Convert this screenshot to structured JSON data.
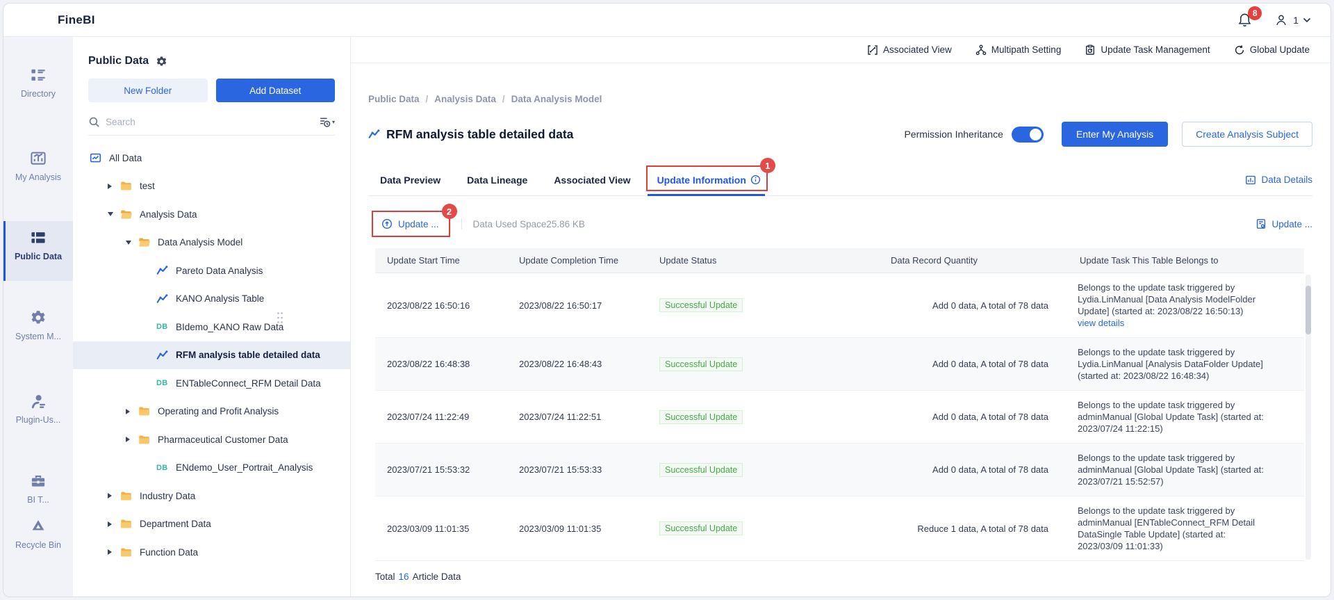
{
  "topbar": {
    "logo": "FineBI",
    "notification_count": "8",
    "user_label": "1"
  },
  "sidebar": {
    "items": [
      {
        "label": "Directory",
        "icon": "directory",
        "active": false,
        "clipped": false
      },
      {
        "label": "My Analysis",
        "icon": "my-analysis",
        "active": false,
        "clipped": false
      },
      {
        "label": "Public Data",
        "icon": "public-data",
        "active": true,
        "clipped": false
      },
      {
        "label": "System M...",
        "icon": "system",
        "active": false,
        "clipped": false
      },
      {
        "label": "Plugin-Us...",
        "icon": "plugin-user",
        "active": false,
        "clipped": false
      },
      {
        "label": "BI T...",
        "icon": "bi-tool",
        "active": false,
        "clipped": true
      },
      {
        "label": "Recycle Bin",
        "icon": "recycle",
        "active": false,
        "clipped": false
      }
    ]
  },
  "panel": {
    "title": "Public Data",
    "new_folder_label": "New Folder",
    "add_dataset_label": "Add Dataset",
    "search_placeholder": "Search",
    "tree": [
      {
        "label": "All Data",
        "type": "all-data",
        "level": 0,
        "state": "none",
        "selected": false
      },
      {
        "label": "test",
        "type": "folder",
        "level": 1,
        "state": "collapsed",
        "selected": false
      },
      {
        "label": "Analysis Data",
        "type": "folder",
        "level": 1,
        "state": "expanded",
        "selected": false
      },
      {
        "label": "Data Analysis Model",
        "type": "folder",
        "level": 2,
        "state": "expanded",
        "selected": false
      },
      {
        "label": "Pareto Data Analysis",
        "type": "analysis",
        "level": 3,
        "state": "none",
        "selected": false
      },
      {
        "label": "KANO Analysis Table",
        "type": "analysis",
        "level": 3,
        "state": "none",
        "selected": false
      },
      {
        "label": "BIdemo_KANO Raw Data",
        "type": "db",
        "level": 3,
        "state": "none",
        "selected": false
      },
      {
        "label": "RFM analysis table detailed data",
        "type": "analysis",
        "level": 3,
        "state": "none",
        "selected": true
      },
      {
        "label": "ENTableConnect_RFM Detail Data",
        "type": "db",
        "level": 3,
        "state": "none",
        "selected": false
      },
      {
        "label": "Operating and Profit Analysis",
        "type": "folder",
        "level": 2,
        "state": "collapsed",
        "selected": false
      },
      {
        "label": "Pharmaceutical Customer Data",
        "type": "folder",
        "level": 2,
        "state": "collapsed",
        "selected": false
      },
      {
        "label": "ENdemo_User_Portrait_Analysis",
        "type": "db",
        "level": 3,
        "state": "none",
        "selected": false
      },
      {
        "label": "Industry Data",
        "type": "folder",
        "level": 1,
        "state": "collapsed",
        "selected": false
      },
      {
        "label": "Department Data",
        "type": "folder",
        "level": 1,
        "state": "collapsed",
        "selected": false
      },
      {
        "label": "Function Data",
        "type": "folder",
        "level": 1,
        "state": "collapsed",
        "selected": false
      }
    ]
  },
  "toolbar": {
    "items": [
      {
        "label": "Associated View",
        "icon": "assoc-view"
      },
      {
        "label": "Multipath Setting",
        "icon": "multipath"
      },
      {
        "label": "Update Task Management",
        "icon": "update-task"
      },
      {
        "label": "Global Update",
        "icon": "global-update"
      }
    ]
  },
  "main": {
    "breadcrumb": [
      "Public Data",
      "Analysis Data",
      "Data Analysis Model"
    ],
    "title": "RFM analysis table detailed data",
    "permission_label": "Permission Inheritance",
    "permission_on": true,
    "enter_button": "Enter My Analysis",
    "create_button": "Create Analysis Subject",
    "tabs": [
      "Data Preview",
      "Data Lineage",
      "Associated View",
      "Update Information"
    ],
    "active_tab": "Update Information",
    "data_details_label": "Data Details",
    "update_button": "Update ...",
    "data_used_space": "Data Used Space25.86 KB",
    "update_link": "Update ...",
    "annotations": {
      "tab_badge": "1",
      "update_badge": "2"
    },
    "table": {
      "columns": [
        "Update Start Time",
        "Update Completion Time",
        "Update Status",
        "Data Record Quantity",
        "Update Task This Table Belongs to"
      ],
      "rows": [
        {
          "start": "2023/08/22 16:50:16",
          "end": "2023/08/22 16:50:17",
          "status": "Successful Update",
          "qty": "Add 0 data, A total of 78 data",
          "task": "Belongs to the update task triggered by Lydia.LinManual [Data Analysis ModelFolder Update] (started at: 2023/08/22 16:50:13)",
          "link": "view details"
        },
        {
          "start": "2023/08/22 16:48:38",
          "end": "2023/08/22 16:48:43",
          "status": "Successful Update",
          "qty": "Add 0 data, A total of 78 data",
          "task": "Belongs to the update task triggered by Lydia.LinManual [Analysis DataFolder Update] (started at: 2023/08/22 16:48:34)",
          "link": ""
        },
        {
          "start": "2023/07/24 11:22:49",
          "end": "2023/07/24 11:22:51",
          "status": "Successful Update",
          "qty": "Add 0 data, A total of 78 data",
          "task": "Belongs to the update task triggered by adminManual [Global Update Task] (started at: 2023/07/24 11:22:15)",
          "link": ""
        },
        {
          "start": "2023/07/21 15:53:32",
          "end": "2023/07/21 15:53:33",
          "status": "Successful Update",
          "qty": "Add 0 data, A total of 78 data",
          "task": "Belongs to the update task triggered by adminManual [Global Update Task] (started at: 2023/07/21 15:52:57)",
          "link": ""
        },
        {
          "start": "2023/03/09 11:01:35",
          "end": "2023/03/09 11:01:35",
          "status": "Successful Update",
          "qty": "Reduce 1 data, A total of 78 data",
          "task": "Belongs to the update task triggered by adminManual [ENTableConnect_RFM Detail DataSingle Table Update] (started at: 2023/03/09 11:01:33)",
          "link": ""
        }
      ]
    },
    "footer": {
      "total_prefix": "Total",
      "total_count": "16",
      "total_suffix": "Article Data"
    }
  },
  "colors": {
    "accent_blue": "#2A66E0",
    "annotation_red": "#E03C3C",
    "status_green": "#4AA64A",
    "folder_yellow": "#F3B14E",
    "db_teal": "#35B8A4"
  }
}
